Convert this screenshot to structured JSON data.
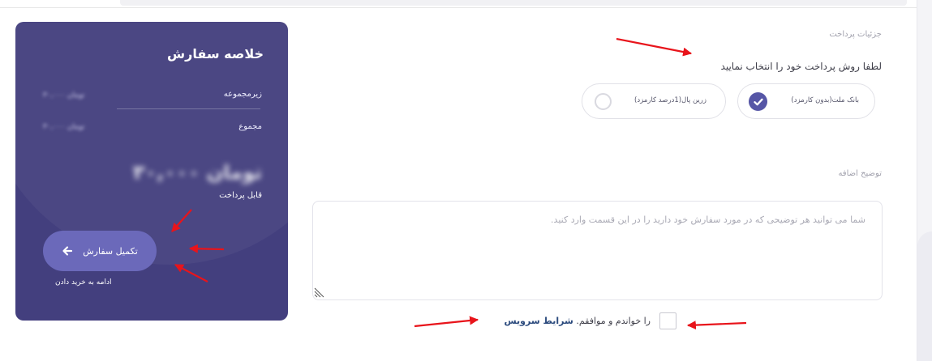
{
  "summary": {
    "title": "خلاصه سفارش",
    "subtotal_label": "زیرمجموعه",
    "subtotal_value": "۳۰,۰۰۰ تومان",
    "total_label": "مجموع",
    "total_value": "۳۰,۰۰۰ تومان",
    "payable_amount": "۳۰,۰۰۰ تومان",
    "payable_label": "قابل پرداخت",
    "complete_button": "تکمیل سفارش",
    "continue_shopping": "ادامه به خرید دادن"
  },
  "payment": {
    "section_title": "جزئیات پرداخت",
    "choose_text": "لطفا روش پرداخت خود را انتخاب نمایید",
    "options": [
      {
        "label": "بانک ملت(بدون کارمزد)",
        "selected": true
      },
      {
        "label": "زرین پال(1درصد کارمزد)",
        "selected": false
      }
    ]
  },
  "notes": {
    "title": "توضیح اضافه",
    "placeholder": "شما می توانید هر توضیحی که در مورد سفارش خود دارید را در این قسمت وارد کنید."
  },
  "terms": {
    "text_before": "را خواندم و موافقم.",
    "link_text": "شرایط سرویس"
  },
  "colors": {
    "card_bg": "#433f7e",
    "button_bg": "#6b69ba",
    "check_bg": "#5656a6",
    "annotation_arrow": "#e8141b"
  }
}
